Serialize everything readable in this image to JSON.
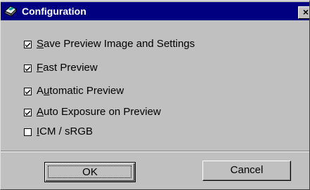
{
  "window": {
    "title": "Configuration",
    "close_glyph": "×"
  },
  "options": [
    {
      "pre": "",
      "key": "S",
      "post": "ave Preview Image and Settings",
      "checked": true
    },
    {
      "pre": "",
      "key": "F",
      "post": "ast Preview",
      "checked": true
    },
    {
      "pre": "A",
      "key": "u",
      "post": "tomatic Preview",
      "checked": true
    },
    {
      "pre": "",
      "key": "A",
      "post": "uto Exposure on Preview",
      "checked": true
    },
    {
      "pre": "",
      "key": "I",
      "post": "CM / sRGB",
      "checked": false
    }
  ],
  "buttons": {
    "ok_label": "OK",
    "cancel_label": "Cancel"
  },
  "colors": {
    "titlebar": "#000080",
    "face": "#c0c0c0"
  }
}
